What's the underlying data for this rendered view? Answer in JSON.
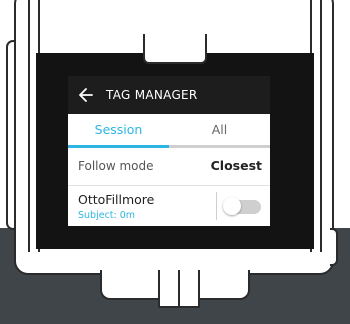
{
  "header": {
    "title": "TAG MANAGER",
    "back_icon": "arrow-left-icon"
  },
  "tabs": [
    {
      "label": "Session",
      "active": true
    },
    {
      "label": "All",
      "active": false
    }
  ],
  "follow_mode": {
    "label": "Follow mode",
    "value": "Closest"
  },
  "subject": {
    "name": "OttoFillmore",
    "detail": "Subject: 0m",
    "toggle_on": false
  },
  "colors": {
    "accent": "#2fb5e2",
    "header_bg": "#1d1d1d",
    "bezel": "#131313",
    "base": "#3f4549"
  }
}
